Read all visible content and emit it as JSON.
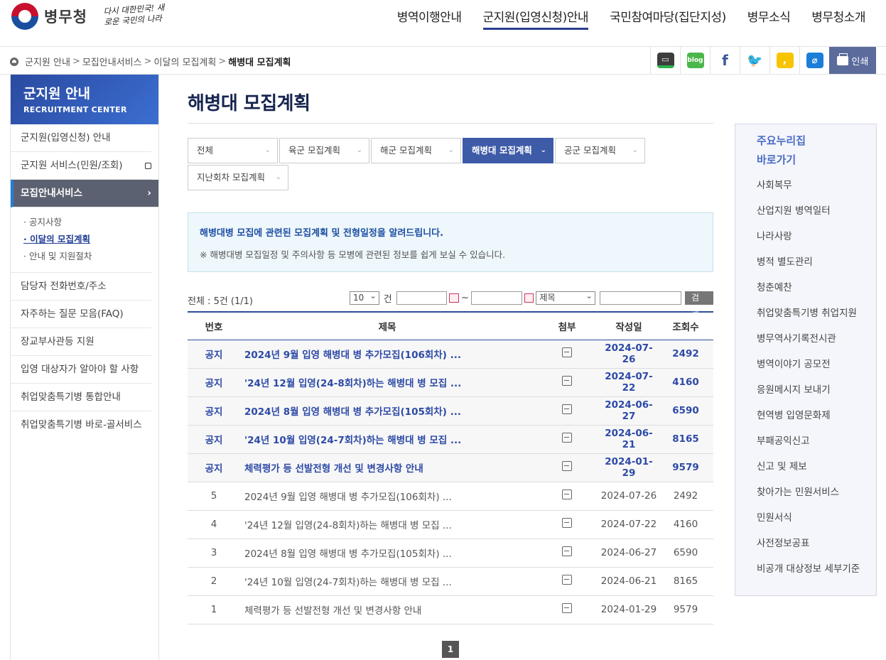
{
  "header": {
    "logo_text": "병무청",
    "slogan": "다시 대한민국! 새로운 국민의 나라",
    "nav": [
      "병역이행안내",
      "군지원(입영신청)안내",
      "국민참여마당(집단지성)",
      "병무소식",
      "병무청소개"
    ]
  },
  "breadcrumb": {
    "items": [
      "군지원 안내",
      "모집안내서비스",
      "이달의 모집계획"
    ],
    "current": "해병대 모집계획"
  },
  "sns": {
    "print_label": "인쇄",
    "blog_label": "blog",
    "facebook_label": "f"
  },
  "lnb": {
    "title": "군지원 안내",
    "subtitle": "RECRUITMENT CENTER",
    "items": [
      "군지원(입영신청) 안내",
      "군지원 서비스(민원/조회)",
      "모집안내서비스"
    ],
    "sub_items": [
      "공지사항",
      "이달의 모집계획",
      "안내 및 지원절차"
    ],
    "more_items": [
      "담당자 전화번호/주소",
      "자주하는 질문 모음(FAQ)",
      "장교부사관등 지원",
      "입영 대상자가 알아야 할 사항",
      "취업맞춤특기병 통합안내",
      "취업맞춤특기병 바로-골서비스"
    ]
  },
  "content": {
    "title": "해병대 모집계획",
    "tabs": [
      "전체",
      "육군 모집계획",
      "해군 모집계획",
      "해병대 모집계획",
      "공군 모집계획",
      "지난회차 모집계획"
    ],
    "info_line1": "해병대병 모집에 관련된 모집계획 및 전형일정을 알려드립니다.",
    "info_line2": "※ 해병대병 모집일정 및 주의사항 등 모병에 관련된 정보를 쉽게 보실 수 있습니다.",
    "total": "전체 : 5건 (1/1)",
    "page_size": "10",
    "unit": "건",
    "tilde": "~",
    "search_field": "제목",
    "search_button": "검색",
    "columns": [
      "번호",
      "제목",
      "첨부",
      "작성일",
      "조회수"
    ],
    "rows": [
      {
        "no": "공지",
        "title": "2024년 9월 입영 해병대 병 추가모집(106회차) ...",
        "date": "2024-07-26",
        "views": "2492",
        "notice": true
      },
      {
        "no": "공지",
        "title": "'24년 12월 입영(24-8회차)하는 해병대 병 모집 ...",
        "date": "2024-07-22",
        "views": "4160",
        "notice": true
      },
      {
        "no": "공지",
        "title": "2024년 8월 입영 해병대 병 추가모집(105회차) ...",
        "date": "2024-06-27",
        "views": "6590",
        "notice": true
      },
      {
        "no": "공지",
        "title": "'24년 10월 입영(24-7회차)하는 해병대 병 모집 ...",
        "date": "2024-06-21",
        "views": "8165",
        "notice": true
      },
      {
        "no": "공지",
        "title": "체력평가 등 선발전형 개선 및 변경사항 안내",
        "date": "2024-01-29",
        "views": "9579",
        "notice": true
      },
      {
        "no": "5",
        "title": "2024년 9월 입영 해병대 병 추가모집(106회차) ...",
        "date": "2024-07-26",
        "views": "2492",
        "notice": false
      },
      {
        "no": "4",
        "title": "'24년 12월 입영(24-8회차)하는 해병대 병 모집 ...",
        "date": "2024-07-22",
        "views": "4160",
        "notice": false
      },
      {
        "no": "3",
        "title": "2024년 8월 입영 해병대 병 추가모집(105회차) ...",
        "date": "2024-06-27",
        "views": "6590",
        "notice": false
      },
      {
        "no": "2",
        "title": "'24년 10월 입영(24-7회차)하는 해병대 병 모집 ...",
        "date": "2024-06-21",
        "views": "8165",
        "notice": false
      },
      {
        "no": "1",
        "title": "체력평가 등 선발전형 개선 및 변경사항 안내",
        "date": "2024-01-29",
        "views": "9579",
        "notice": false
      }
    ],
    "current_page": "1"
  },
  "quick": {
    "title1": "주요누리집",
    "title2": "바로가기",
    "items": [
      "사회복무",
      "산업지원 병역일터",
      "나라사랑",
      "병적 별도관리",
      "청춘예찬",
      "취업맞춤특기병 취업지원",
      "병무역사기록전시관",
      "병역이야기 공모전",
      "응원메시지 보내기",
      "현역병 입영문화제",
      "부패공익신고",
      "신고 및 제보",
      "찾아가는 민원서비스",
      "민원서식",
      "사전정보공표",
      "비공개 대상정보 세부기준"
    ]
  },
  "colors": {
    "accent": "#3e5ba8",
    "notice_text": "#2d4aa6",
    "lnb_active": "#5b6170"
  }
}
